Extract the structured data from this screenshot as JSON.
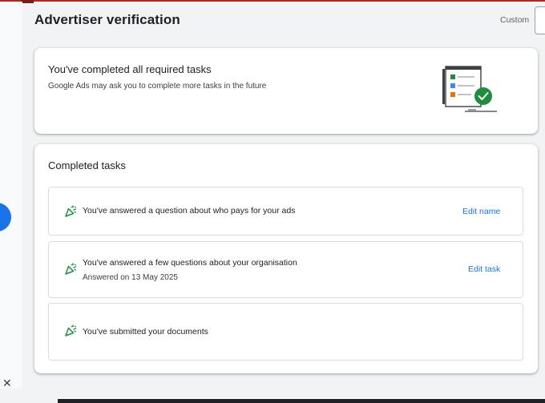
{
  "header": {
    "title": "Advertiser verification",
    "custom_label": "Custom"
  },
  "summary": {
    "title": "You've completed all required tasks",
    "subtitle": "Google Ads may ask you to complete more tasks in the future"
  },
  "tasks": {
    "title": "Completed tasks",
    "items": [
      {
        "text": "You've answered a question about who pays for your ads",
        "action": "Edit name"
      },
      {
        "text": "You've answered a few questions about your organisation",
        "sub": "Answered on 13 May 2025",
        "action": "Edit task"
      },
      {
        "text": "You've submitted your documents"
      }
    ]
  },
  "left_rail": {
    "close_glyph": "✕"
  },
  "colors": {
    "accent": "#1a73e8",
    "success": "#1e8e3e",
    "card_bg": "#ffffff",
    "page_bg": "#f1f3f4"
  },
  "icons": {
    "task_done": "celebration-icon",
    "illustration": "checklist-complete-illustration"
  }
}
